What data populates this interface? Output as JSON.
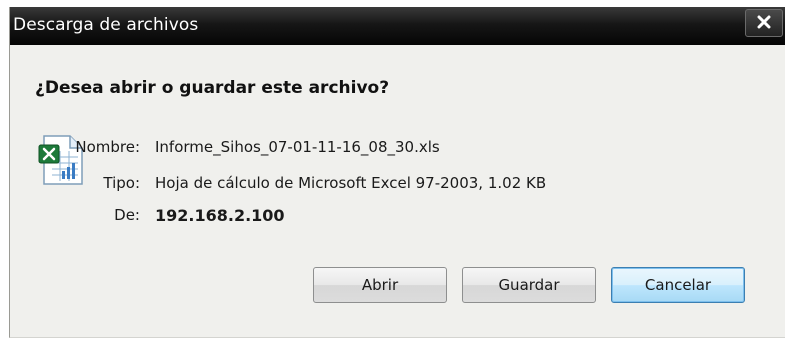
{
  "window": {
    "title": "Descarga de archivos",
    "close_glyph": "✕"
  },
  "prompt": {
    "question": "¿Desea abrir o guardar este archivo?"
  },
  "file": {
    "icon": "excel-file-icon",
    "name_label": "Nombre:",
    "name_value": "Informe_Sihos_07-01-11-16_08_30.xls",
    "type_label": "Tipo:",
    "type_value": "Hoja de cálculo de Microsoft Excel 97-2003, 1.02 KB",
    "from_label": "De:",
    "from_value": "192.168.2.100"
  },
  "buttons": {
    "open": "Abrir",
    "save": "Guardar",
    "cancel": "Cancelar"
  },
  "colors": {
    "titlebar": "#0d0d0d",
    "dialog_bg": "#f0f0ed",
    "focus_border": "#3c7fb1",
    "excel_green": "#1d7a3a"
  }
}
